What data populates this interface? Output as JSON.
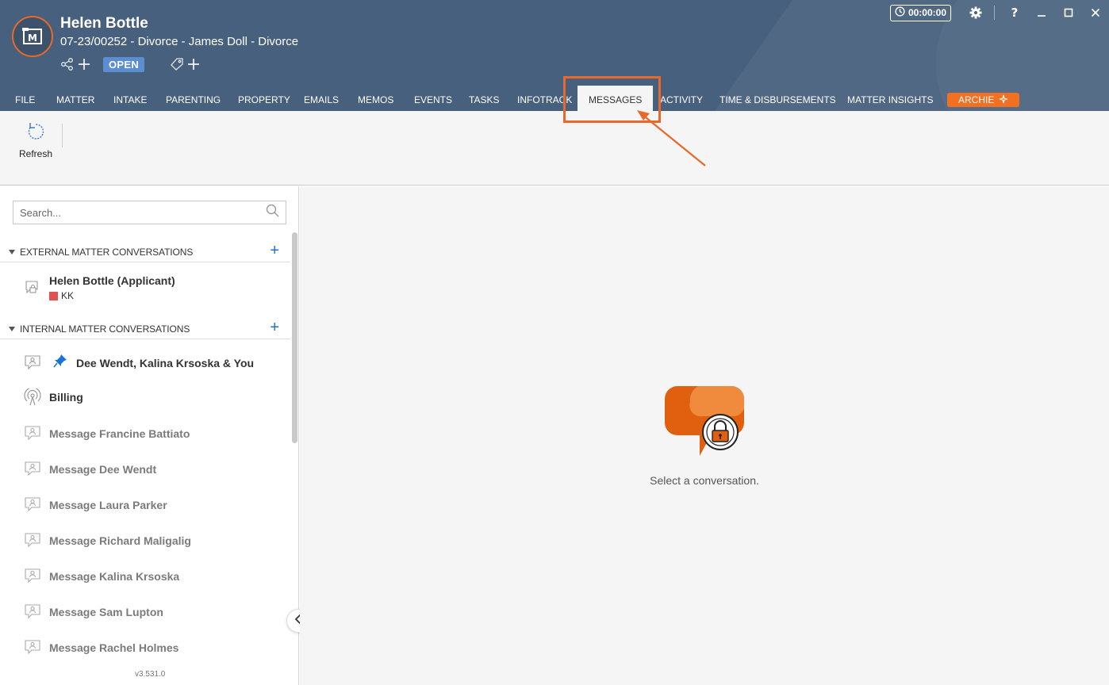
{
  "header": {
    "title": "Helen Bottle",
    "subtitle": "07-23/00252 - Divorce - James Doll - Divorce",
    "status_badge": "OPEN",
    "timer": "00:00:00"
  },
  "tabs": [
    {
      "label": "FILE"
    },
    {
      "label": "MATTER"
    },
    {
      "label": "INTAKE"
    },
    {
      "label": "PARENTING"
    },
    {
      "label": "PROPERTY"
    },
    {
      "label": "EMAILS"
    },
    {
      "label": "MEMOS"
    },
    {
      "label": "EVENTS"
    },
    {
      "label": "TASKS"
    },
    {
      "label": "INFOTRACK"
    },
    {
      "label": "MESSAGES"
    },
    {
      "label": "ACTIVITY"
    },
    {
      "label": "TIME & DISBURSEMENTS"
    },
    {
      "label": "MATTER INSIGHTS"
    },
    {
      "label": "ARCHIE"
    }
  ],
  "toolbar": {
    "refresh_label": "Refresh"
  },
  "sidebar": {
    "search_placeholder": "Search...",
    "external_header": "EXTERNAL MATTER CONVERSATIONS",
    "internal_header": "INTERNAL MATTER CONVERSATIONS",
    "external": [
      {
        "name": "Helen Bottle (Applicant)",
        "tag": "KK"
      }
    ],
    "internal": [
      {
        "name": "Dee Wendt, Kalina Krsoska & You"
      },
      {
        "name": "Billing"
      },
      {
        "name": "Message Francine Battiato"
      },
      {
        "name": "Message Dee Wendt"
      },
      {
        "name": "Message Laura Parker"
      },
      {
        "name": "Message Richard Maligalig"
      },
      {
        "name": "Message Kalina Krsoska"
      },
      {
        "name": "Message Sam Lupton"
      },
      {
        "name": "Message Rachel Holmes"
      }
    ],
    "version": "v3.531.0"
  },
  "main": {
    "empty_message": "Select a conversation."
  },
  "colors": {
    "header_bg": "#47607d",
    "accent": "#e8692a",
    "badge": "#5a8ed1",
    "link_blue": "#1a73d9"
  }
}
